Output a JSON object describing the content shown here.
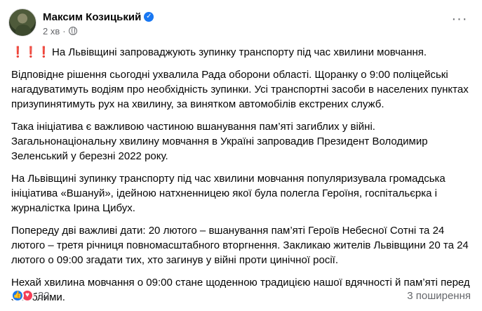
{
  "post": {
    "author": "Максим Козицький",
    "time": "2 хв",
    "meta_separator": "·",
    "paragraphs": [
      "На Львівщині запроваджують зупинку транспорту під час хвилини мовчання.",
      "Відповідне рішення сьогодні ухвалила Рада оборони області. Щоранку о 9:00 поліцейські нагадуватимуть водіям про необхідність зупинки. Усі транспортні засоби в населених пунктах призупинятимуть рух на хвилину, за винятком автомобілів екстрених служб.",
      "Така ініціатива є важливою частиною вшанування пам’яті загиблих у війні. Загальнонаціональну хвилину мовчання в Україні запровадив Президент Володимир Зеленський у березні 2022 року.",
      "На Львівщині зупинку транспорту під час хвилини мовчання популяризувала громадська ініціатива «Вшануй», ідейною натхненницею якої була полегла Героїня, госпітальєрка і журналістка Ірина Цибух.",
      "Попереду дві важливі дати: 20 лютого – вшанування пам’яті Героїв Небесної Сотні та 24 лютого – третя річниця повномасштабного вторгнення. Закликаю жителів Львівщини 20 та 24 лютого о 09:00 згадати тих, хто загинув у війні проти цинічної росії.",
      "Нехай хвилина мовчання о 09:00 стане щоденною традицією нашої вдячності й пам’яті перед загиблими."
    ],
    "exclamations": "❗❗❗",
    "reaction_count": "32",
    "shares": "3 поширення",
    "more_icon": "···",
    "verified_icon": "✓",
    "icons": {
      "like": "👍",
      "love": "♥"
    }
  }
}
